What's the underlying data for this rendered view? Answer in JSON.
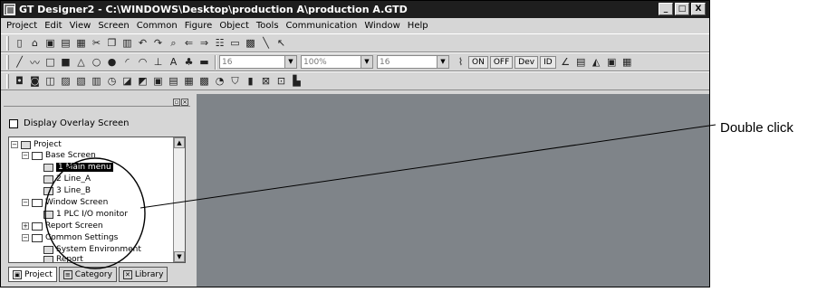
{
  "window": {
    "title": "GT Designer2 - C:\\WINDOWS\\Desktop\\production A\\production A.GTD",
    "buttons": [
      "_",
      "□",
      "X"
    ]
  },
  "menu": [
    "Project",
    "Edit",
    "View",
    "Screen",
    "Common",
    "Figure",
    "Object",
    "Tools",
    "Communication",
    "Window",
    "Help"
  ],
  "toolbar2": {
    "combo1": "16",
    "combo2": "100%",
    "combo3": "16",
    "on": "ON",
    "off": "OFF",
    "dev": "Dev",
    "id": "ID"
  },
  "pane": {
    "overlay_label": "Display Overlay Screen",
    "tree": {
      "project": "Project",
      "base_screen": "Base Screen",
      "item1": "1 Main menu",
      "item2": "2 Line_A",
      "item3": "3 Line_B",
      "window_screen": "Window Screen",
      "window_item": "1 PLC I/O monitor",
      "report_screen": "Report Screen",
      "common_settings": "Common Settings",
      "system_env": "System Environment",
      "report": "Report"
    },
    "tabs": [
      "Project",
      "Category",
      "Library"
    ]
  },
  "callout": "Double click",
  "colors": {
    "editor_bg": "#7f8489",
    "titlebar_bg": "#1e1e1e",
    "chrome": "#d6d6d6"
  }
}
